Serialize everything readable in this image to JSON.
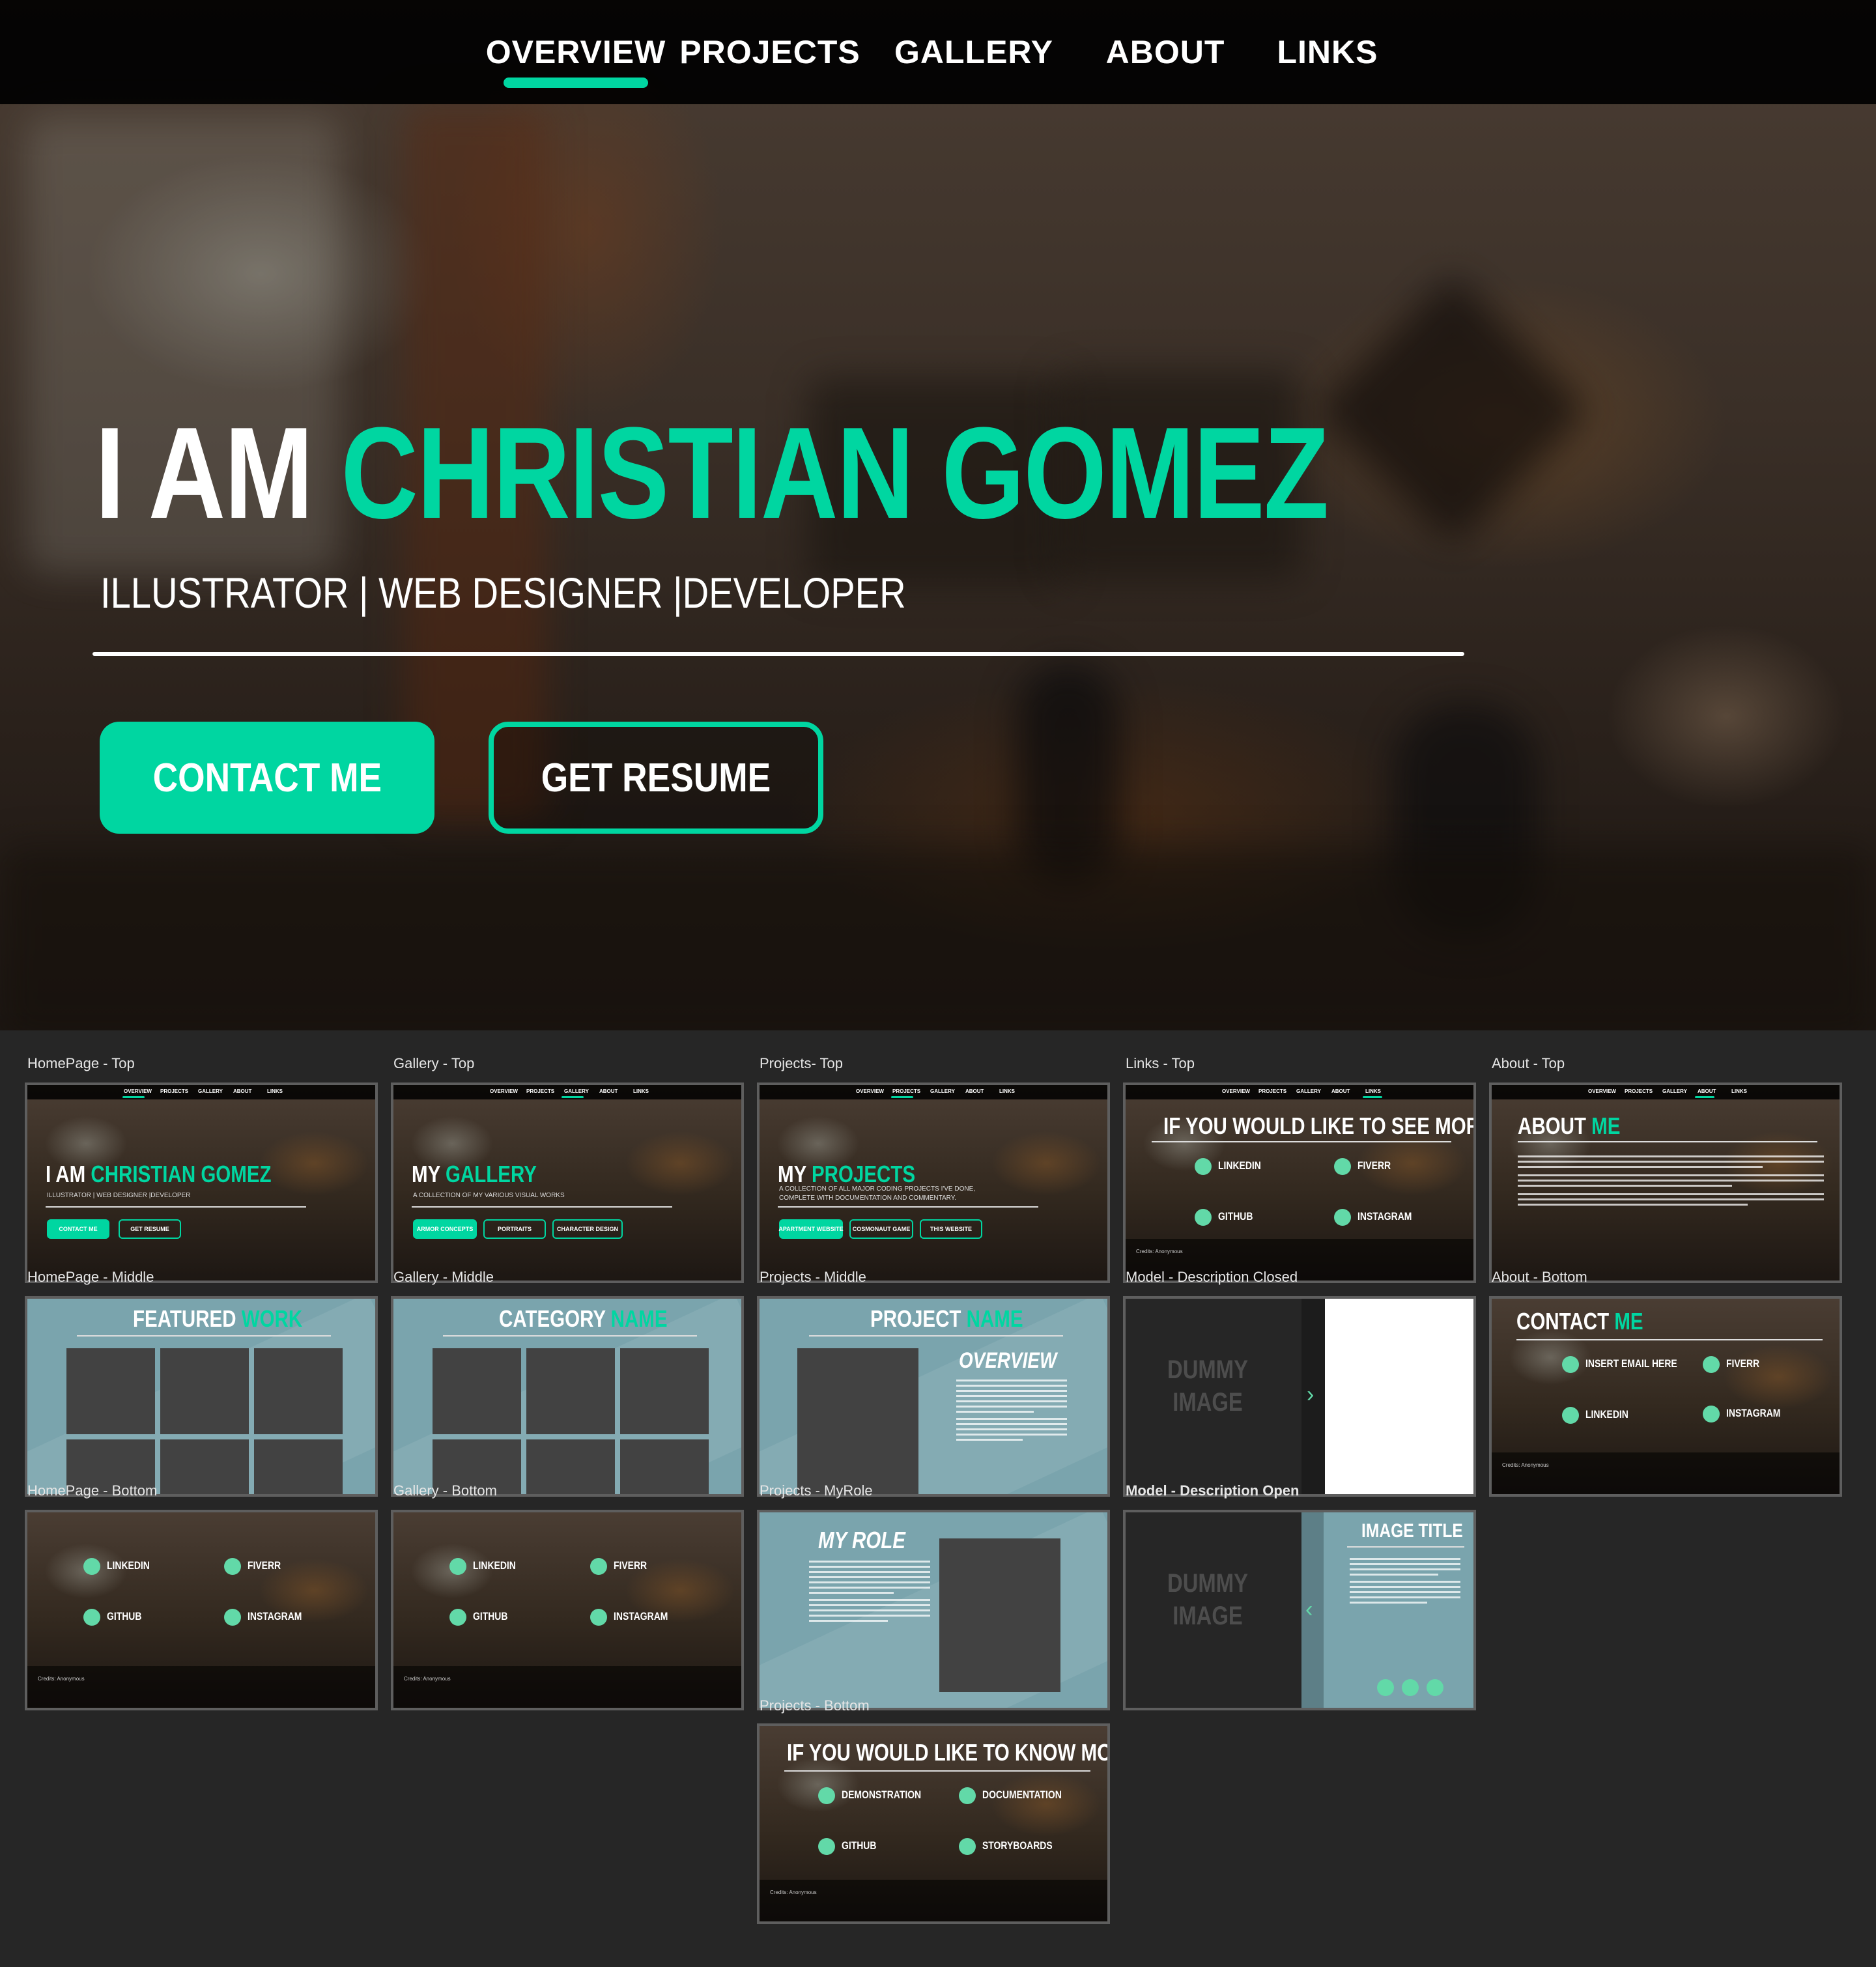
{
  "nav": {
    "items": [
      {
        "label": "OVERVIEW",
        "active": true
      },
      {
        "label": "PROJECTS"
      },
      {
        "label": "GALLERY"
      },
      {
        "label": "ABOUT"
      },
      {
        "label": "LINKS"
      }
    ],
    "accent": "#00d6a1"
  },
  "hero": {
    "title_prefix": "I AM ",
    "title_name": "CHRISTIAN GOMEZ",
    "subtitle": "ILLUSTRATOR | WEB DESIGNER |DEVELOPER",
    "contact_label": "CONTACT ME",
    "resume_label": "GET RESUME"
  },
  "artboards": {
    "labels": {
      "home_top": "HomePage - Top",
      "gallery_top": "Gallery - Top",
      "projects_top": "Projects- Top",
      "links_top": "Links - Top",
      "about_top": "About - Top",
      "home_middle": "HomePage - Middle",
      "gallery_middle": "Gallery - Middle",
      "projects_middle": "Projects - Middle",
      "model_closed": "Model - Description Closed",
      "about_bottom": "About - Bottom",
      "home_bottom": "HomePage - Bottom",
      "gallery_bottom": "Gallery - Bottom",
      "projects_myrole": "Projects - MyRole",
      "model_open": "Model - Description Open",
      "projects_bottom": "Projects - Bottom"
    },
    "mini_nav": [
      "OVERVIEW",
      "PROJECTS",
      "GALLERY",
      "ABOUT",
      "LINKS"
    ],
    "home_top": {
      "prefix": "I AM ",
      "name": "CHRISTIAN GOMEZ",
      "sub": "ILLUSTRATOR | WEB DESIGNER |DEVELOPER",
      "btn1": "CONTACT ME",
      "btn2": "GET RESUME"
    },
    "gallery_top": {
      "prefix": "MY ",
      "name": "GALLERY",
      "sub": "A COLLECTION OF MY VARIOUS VISUAL WORKS",
      "btn1": "ARMOR CONCEPTS",
      "btn2": "PORTRAITS",
      "btn3": "CHARACTER DESIGN"
    },
    "projects_top": {
      "prefix": "MY ",
      "name": "PROJECTS",
      "sub1": "A COLLECTION OF ALL MAJOR CODING PROJECTS I'VE DONE,",
      "sub2": "COMPLETE WITH DOCUMENTATION AND COMMENTARY.",
      "btn1": "APARTMENT WEBSITE",
      "btn2": "COSMONAUT GAME",
      "btn3": "THIS WEBSITE"
    },
    "links_top": {
      "title": "IF YOU WOULD LIKE TO SEE MORE",
      "l1": "LINKEDIN",
      "l2": "FIVERR",
      "l3": "GITHUB",
      "l4": "INSTAGRAM",
      "credit": "Credits: Anonymous"
    },
    "about_top": {
      "prefix": "ABOUT ",
      "name": "ME"
    },
    "home_middle": {
      "prefix": "FEATURED ",
      "name": "WORK"
    },
    "gallery_middle": {
      "prefix": "CATEGORY ",
      "name": "NAME"
    },
    "projects_middle": {
      "prefix": "PROJECT ",
      "name": "NAME",
      "overview": "OVERVIEW"
    },
    "model_closed": {
      "dummy": "DUMMY IMAGE"
    },
    "about_bottom": {
      "prefix": "CONTACT ",
      "name": "ME",
      "l1": "INSERT EMAIL HERE",
      "l2": "FIVERR",
      "l3": "LINKEDIN",
      "l4": "INSTAGRAM",
      "credit": "Credits: Anonymous"
    },
    "home_bottom": {
      "l1": "LINKEDIN",
      "l2": "FIVERR",
      "l3": "GITHUB",
      "l4": "INSTAGRAM",
      "credit": "Credits: Anonymous"
    },
    "gallery_bottom": {
      "l1": "LINKEDIN",
      "l2": "FIVERR",
      "l3": "GITHUB",
      "l4": "INSTAGRAM",
      "credit": "Credits: Anonymous"
    },
    "projects_myrole": {
      "title": "MY ROLE"
    },
    "model_open": {
      "dummy": "DUMMY IMAGE",
      "title": "IMAGE TITLE"
    },
    "projects_bottom": {
      "title": "IF YOU WOULD LIKE TO KNOW MORE",
      "l1": "DEMONSTRATION",
      "l2": "DOCUMENTATION",
      "l3": "GITHUB",
      "l4": "STORYBOARDS",
      "credit": "Credits: Anonymous"
    }
  }
}
